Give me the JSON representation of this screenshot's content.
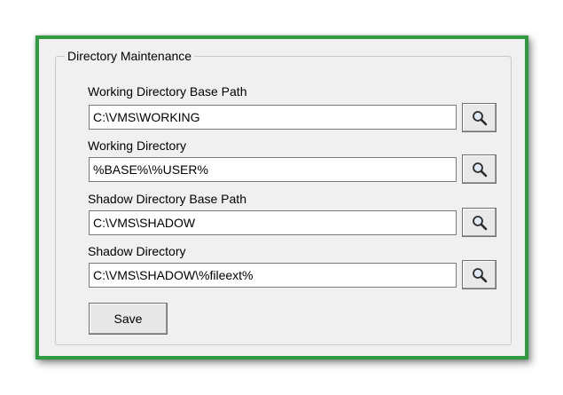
{
  "group": {
    "title": "Directory Maintenance"
  },
  "fields": [
    {
      "label": "Working Directory Base Path",
      "value": "C:\\VMS\\WORKING"
    },
    {
      "label": "Working Directory",
      "value": "%BASE%\\%USER%"
    },
    {
      "label": "Shadow Directory Base Path",
      "value": "C:\\VMS\\SHADOW"
    },
    {
      "label": "Shadow Directory",
      "value": "C:\\VMS\\SHADOW\\%fileext%"
    }
  ],
  "buttons": {
    "save_label": "Save",
    "browse_icon": "magnifier-icon"
  },
  "colors": {
    "frame_border": "#2f9a3f",
    "panel_bg": "#f0f0f0"
  }
}
